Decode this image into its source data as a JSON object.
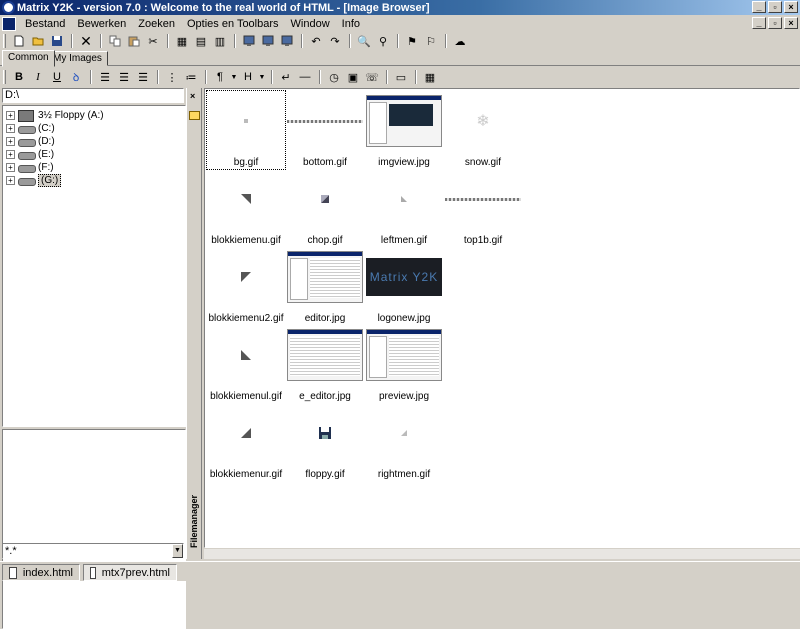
{
  "window": {
    "title": "Matrix Y2K - version 7.0 : Welcome to the real world of HTML - [Image Browser]"
  },
  "menu": [
    "Bestand",
    "Bewerken",
    "Zoeken",
    "Opties en Toolbars",
    "Window",
    "Info"
  ],
  "tabs": [
    "Common",
    "My Images"
  ],
  "path": "D:\\",
  "drives": [
    {
      "label": "3½ Floppy (A:)"
    },
    {
      "label": "(C:)"
    },
    {
      "label": "(D:)"
    },
    {
      "label": "(E:)"
    },
    {
      "label": "(F:)"
    },
    {
      "label": "(G:)"
    }
  ],
  "filter": "*.*",
  "side_label": "Filemanager",
  "files": [
    {
      "name": "bg.gif"
    },
    {
      "name": "bottom.gif"
    },
    {
      "name": "imgview.jpg"
    },
    {
      "name": "snow.gif"
    },
    {
      "name": "blokkiemenu.gif"
    },
    {
      "name": "chop.gif"
    },
    {
      "name": "leftmen.gif"
    },
    {
      "name": "top1b.gif"
    },
    {
      "name": "blokkiemenu2.gif"
    },
    {
      "name": "editor.jpg"
    },
    {
      "name": "logonew.jpg"
    },
    {
      "name": "blokkiemenul.gif"
    },
    {
      "name": "e_editor.jpg"
    },
    {
      "name": "preview.jpg"
    },
    {
      "name": "blokkiemenur.gif"
    },
    {
      "name": "floppy.gif"
    },
    {
      "name": "rightmen.gif"
    }
  ],
  "logo_text": "Matrix Y2K",
  "toolbar2": {
    "bold": "B",
    "italic": "I",
    "underline": "U",
    "para": "¶",
    "heading": "H"
  },
  "documents": [
    "index.html",
    "mtx7prev.html"
  ]
}
